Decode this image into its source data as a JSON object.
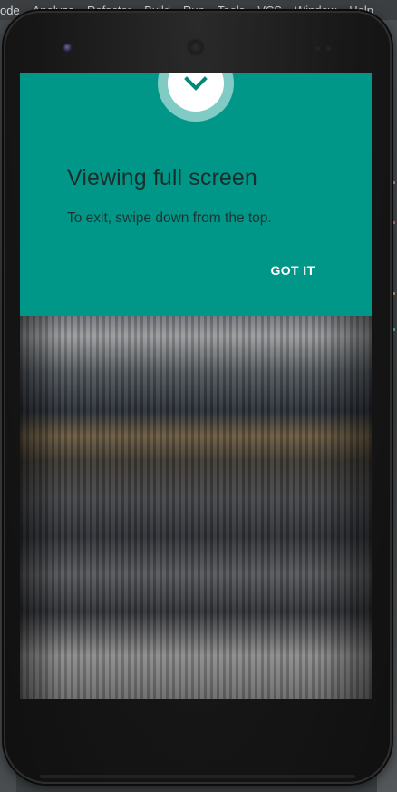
{
  "ide": {
    "menu": [
      "ode",
      "Analyze",
      "Refactor",
      "Build",
      "Run",
      "Tools",
      "VCS",
      "Window",
      "Help"
    ],
    "accent_colors": [
      "#e06c75",
      "#c678dd",
      "#d19a66",
      "#56b6c2"
    ]
  },
  "device": {
    "model_shape": "android-phone"
  },
  "immersive_dialog": {
    "icon": "chevron-down-icon",
    "title": "Viewing full screen",
    "message": "To exit, swipe down from the top.",
    "confirm_label": "GOT IT",
    "background_color": "#009688",
    "badge_ring_color": "#80cbc4",
    "badge_color": "#ffffff",
    "icon_color": "#00897b"
  }
}
